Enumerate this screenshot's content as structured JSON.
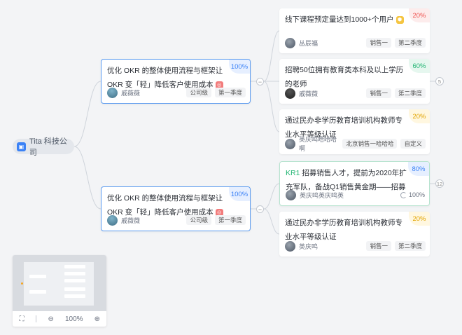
{
  "root": {
    "label": "Tita 科技公司"
  },
  "objectives": [
    {
      "title": "优化 OKR 的整体使用流程与框架让 OKR 变「轻」降低客户使用成本",
      "percent": "100%",
      "owner": "戚薇薇",
      "level": "公司级",
      "period": "第一季度"
    },
    {
      "title": "优化 OKR 的整体使用流程与框架让 OKR 变「轻」降低客户使用成本",
      "percent": "100%",
      "owner": "戚薇薇",
      "level": "公司级",
      "period": "第一季度"
    }
  ],
  "group1": {
    "collapse_symbol": "−",
    "extra_count": "5",
    "items": [
      {
        "title": "线下课程预定量达到1000+个用户",
        "percent": "20%",
        "owner": "丛辰福",
        "tag1": "销售一",
        "tag2": "第二季度"
      },
      {
        "title": "招聘50位拥有教育类本科及以上学历的老师",
        "percent": "60%",
        "owner": "戚薇薇",
        "tag1": "销售一",
        "tag2": "第二季度"
      },
      {
        "title": "通过民办非学历教育培训机构教师专业水平等级认证",
        "percent": "20%",
        "owner": "英庆鸣哈哈哈啊",
        "tag1": "北京销售一哈哈哈",
        "tag2": "自定义"
      }
    ]
  },
  "group2": {
    "collapse_symbol": "−",
    "extra_count": "12",
    "items": [
      {
        "kr_label": "KR1",
        "title": "招募销售人才，提前为2020年扩充军队，备战Q1销售黄金期——招募",
        "percent": "80%",
        "owner": "英庆鸣英庆鸣英",
        "progress": "100%"
      },
      {
        "title": "通过民办非学历教育培训机构教师专业水平等级认证",
        "percent": "20%",
        "owner": "英庆鸣",
        "tag1": "销售一",
        "tag2": "第二季度"
      }
    ]
  },
  "minimap": {
    "zoom": "100%",
    "fit_icon": "⛶",
    "zoom_out_icon": "⊖",
    "zoom_in_icon": "⊕"
  },
  "colors": {
    "accent": "#3b82f6",
    "red": "#ef5350",
    "green": "#22b573",
    "yellow": "#e2a400"
  }
}
